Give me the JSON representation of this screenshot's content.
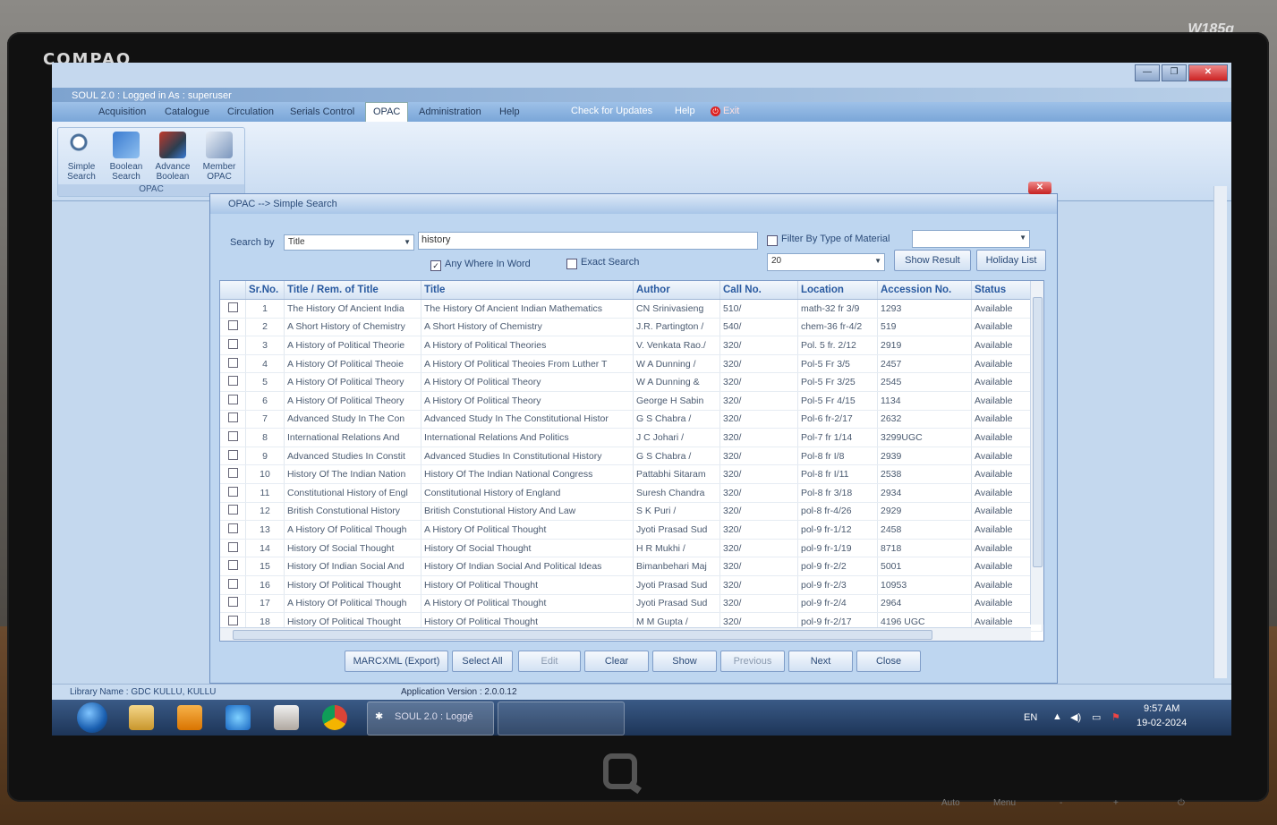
{
  "monitor": {
    "brand": "COMPAQ",
    "model": "W185q",
    "buttons": [
      "Auto",
      "Menu",
      "-",
      "+"
    ]
  },
  "window": {
    "title": "SOUL 2.0 : Logged in As : superuser",
    "controls": {
      "minimize": "—",
      "maximize": "❐",
      "close": "✕"
    }
  },
  "ribbon": {
    "tabs": [
      "Acquisition",
      "Catalogue",
      "Circulation",
      "Serials Control",
      "OPAC",
      "Administration",
      "Help"
    ],
    "active_tab": "OPAC",
    "extra": [
      "Check for Updates",
      "Help",
      "Exit"
    ],
    "group_label": "OPAC",
    "buttons": [
      {
        "label": "Simple Search",
        "icon": "magnifier-icon"
      },
      {
        "label": "Boolean Search",
        "icon": "boolean-search-icon"
      },
      {
        "label": "Advance Boolean",
        "icon": "advance-boolean-icon"
      },
      {
        "label": "Member OPAC",
        "icon": "member-opac-icon"
      }
    ]
  },
  "dialog": {
    "title": "OPAC --> Simple Search",
    "search_by_label": "Search by",
    "search_by_value": "Title",
    "search_text": "history",
    "filter_label": "Filter By Type of Material",
    "filter_value": "",
    "any_where_label": "Any Where In Word",
    "any_where_checked": true,
    "exact_label": "Exact Search",
    "exact_checked": false,
    "page_size": "20",
    "show_result": "Show Result",
    "holiday_list": "Holiday List",
    "columns": [
      "",
      "Sr.No.",
      "Title / Rem. of Title",
      "Title",
      "Author",
      "Call No.",
      "Location",
      "Accession No.",
      "Status"
    ],
    "rows": [
      [
        "1",
        "The History Of Ancient India",
        "The History Of Ancient Indian Mathematics",
        "CN Srinivasieng",
        "510/",
        "math-32 fr 3/9",
        "1293",
        "Available"
      ],
      [
        "2",
        "A Short History of Chemistry",
        "A Short History of Chemistry",
        "J.R. Partington /",
        "540/",
        "chem-36 fr-4/2",
        "519",
        "Available"
      ],
      [
        "3",
        "A History of Political Theorie",
        "A History of Political Theories",
        "V. Venkata Rao./",
        "320/",
        "Pol. 5 fr. 2/12",
        "2919",
        "Available"
      ],
      [
        "4",
        "A History Of Political Theoie",
        "A History Of Political Theoies From Luther T",
        "W A Dunning /",
        "320/",
        "Pol-5 Fr 3/5",
        "2457",
        "Available"
      ],
      [
        "5",
        "A History Of Political Theory",
        "A History Of Political Theory",
        "W A Dunning &",
        "320/",
        "Pol-5 Fr 3/25",
        "2545",
        "Available"
      ],
      [
        "6",
        "A History Of Political Theory",
        "A History Of Political Theory",
        "George H Sabin",
        "320/",
        "Pol-5 Fr 4/15",
        "1134",
        "Available"
      ],
      [
        "7",
        "Advanced Study In The Con",
        "Advanced Study In The Constitutional Histor",
        "G S Chabra /",
        "320/",
        "Pol-6 fr-2/17",
        "2632",
        "Available"
      ],
      [
        "8",
        "International Relations And",
        "International Relations And Politics",
        "J C Johari /",
        "320/",
        "Pol-7 fr 1/14",
        "3299UGC",
        "Available"
      ],
      [
        "9",
        "Advanced Studies In Constit",
        "Advanced Studies In Constitutional History",
        "G S Chabra /",
        "320/",
        "Pol-8 fr I/8",
        "2939",
        "Available"
      ],
      [
        "10",
        "History Of The Indian Nation",
        "History Of The Indian National Congress",
        "Pattabhi Sitaram",
        "320/",
        "Pol-8 fr I/11",
        "2538",
        "Available"
      ],
      [
        "11",
        "Constitutional History of Engl",
        "Constitutional History of England",
        "Suresh Chandra",
        "320/",
        "Pol-8 fr 3/18",
        "2934",
        "Available"
      ],
      [
        "12",
        "British Constutional History",
        "British Constutional History And Law",
        "S K Puri /",
        "320/",
        "pol-8 fr-4/26",
        "2929",
        "Available"
      ],
      [
        "13",
        "A History Of Political Though",
        "A History Of Political Thought",
        "Jyoti Prasad Sud",
        "320/",
        "pol-9 fr-1/12",
        "2458",
        "Available"
      ],
      [
        "14",
        "History Of Social Thought",
        "History Of Social Thought",
        "H R Mukhi /",
        "320/",
        "pol-9 fr-1/19",
        "8718",
        "Available"
      ],
      [
        "15",
        "History Of Indian Social And",
        "History Of Indian Social And Political Ideas",
        "Bimanbehari Maj",
        "320/",
        "pol-9 fr-2/2",
        "5001",
        "Available"
      ],
      [
        "16",
        "History Of Political Thought",
        "History Of Political Thought",
        "Jyoti Prasad Sud",
        "320/",
        "pol-9 fr-2/3",
        "10953",
        "Available"
      ],
      [
        "17",
        "A History Of Political Though",
        "A History Of Political Thought",
        "Jyoti Prasad Sud",
        "320/",
        "pol-9 fr-2/4",
        "2964",
        "Available"
      ],
      [
        "18",
        "History Of Political Thought",
        "History Of Political Thought",
        "M M Gupta /",
        "320/",
        "pol-9 fr-2/17",
        "4196 UGC",
        "Available"
      ]
    ],
    "buttons": {
      "marcxml": "MARCXML (Export)",
      "select_all": "Select All",
      "edit": "Edit",
      "clear": "Clear",
      "show": "Show",
      "previous": "Previous",
      "next": "Next",
      "close": "Close"
    }
  },
  "status_bar": {
    "library": "Library Name : GDC KULLU, KULLU",
    "version": "Application Version : 2.0.0.12"
  },
  "taskbar": {
    "task_label": "SOUL 2.0 : Loggé",
    "lang": "EN",
    "time": "9:57 AM",
    "date": "19-02-2024"
  }
}
